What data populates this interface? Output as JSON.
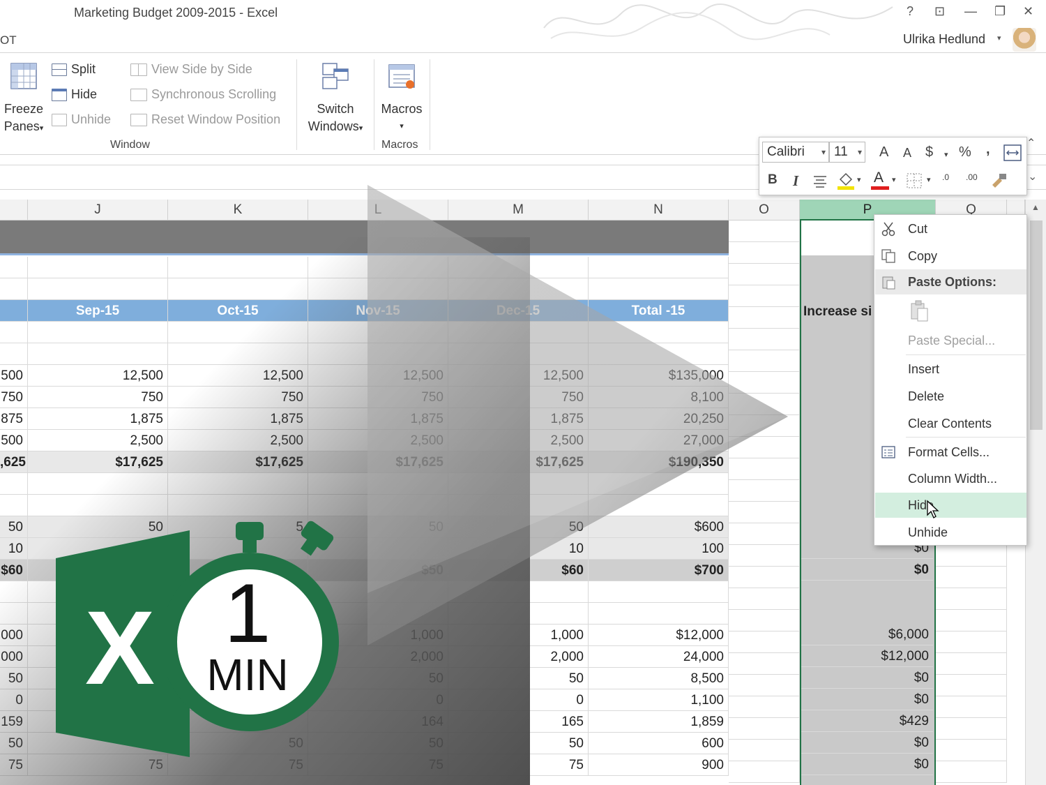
{
  "window": {
    "title": "Marketing Budget 2009-2015 - Excel",
    "tab_fragment": "OT",
    "user_name": "Ulrika Hedlund",
    "help": "?",
    "controls": [
      "⊡",
      "—",
      "❐",
      "✕"
    ]
  },
  "ribbon": {
    "freeze_label_1": "Freeze",
    "freeze_label_2": "Panes",
    "split": "Split",
    "hide": "Hide",
    "unhide": "Unhide",
    "view_side_by_side": "View Side by Side",
    "sync_scrolling": "Synchronous Scrolling",
    "reset_window": "Reset Window Position",
    "switch_1": "Switch",
    "switch_2": "Windows",
    "macros": "Macros",
    "group_window": "Window",
    "group_macros": "Macros",
    "dropdown_arrow": "▾"
  },
  "columns": [
    "J",
    "K",
    "L",
    "M",
    "N",
    "O",
    "P",
    "Q"
  ],
  "sheet": {
    "header_row": [
      "Sep-15",
      "Oct-15",
      "Nov-15",
      "Dec-15",
      "Total -15"
    ],
    "p_header": "Increase si",
    "left_col": [
      "500",
      "750",
      "875",
      "500",
      ",625",
      "50",
      "10",
      "$60",
      "000",
      "000",
      "50",
      "0",
      "159",
      "50",
      "75"
    ],
    "rows_a": [
      [
        "12,500",
        "12,500",
        "12,500",
        "12,500",
        "$135,000"
      ],
      [
        "750",
        "750",
        "750",
        "750",
        "8,100"
      ],
      [
        "1,875",
        "1,875",
        "1,875",
        "1,875",
        "20,250"
      ],
      [
        "2,500",
        "2,500",
        "2,500",
        "2,500",
        "27,000"
      ],
      [
        "$17,625",
        "$17,625",
        "$17,625",
        "$17,625",
        "$190,350"
      ]
    ],
    "rows_b": [
      [
        "50",
        "5",
        "50",
        "50",
        "$600"
      ],
      [
        "",
        "",
        "",
        "10",
        "100"
      ],
      [
        "",
        "",
        "$50",
        "$60",
        "$700"
      ]
    ],
    "rows_c": [
      [
        "",
        "",
        "1,000",
        "1,000",
        "$12,000"
      ],
      [
        "",
        "",
        "2,000",
        "2,000",
        "24,000"
      ],
      [
        "",
        "",
        "50",
        "50",
        "8,500"
      ],
      [
        "",
        "",
        "0",
        "0",
        "1,100"
      ],
      [
        "",
        "",
        "164",
        "165",
        "1,859"
      ],
      [
        "",
        "50",
        "50",
        "50",
        "600"
      ],
      [
        "75",
        "75",
        "75",
        "75",
        "900"
      ]
    ],
    "p_values": [
      "$0",
      "$0",
      "$6,000",
      "$12,000",
      "$0",
      "$0",
      "$429",
      "$0",
      "$0"
    ]
  },
  "mini_toolbar": {
    "font": "Calibri",
    "size": "11",
    "grow": "A",
    "shrink": "A",
    "currency": "$",
    "percent": "%",
    "comma": ",",
    "bold": "B",
    "italic": "I",
    "font_color": "A",
    "dec_inc": ".0",
    "dec_dec": ".00"
  },
  "context_menu": {
    "cut": "Cut",
    "copy": "Copy",
    "paste_options": "Paste Options:",
    "paste_special": "Paste Special...",
    "insert": "Insert",
    "delete": "Delete",
    "clear_contents": "Clear Contents",
    "format_cells": "Format Cells...",
    "column_width": "Column Width...",
    "hide": "Hide",
    "unhide": "Unhide"
  },
  "overlay": {
    "logo_letter": "X",
    "timer_number": "1",
    "timer_unit": "MIN"
  },
  "colors": {
    "excel_green": "#217346",
    "header_blue": "#7faedc",
    "selected_column": "#9fd5b7",
    "menu_hover": "#d3eedf"
  }
}
